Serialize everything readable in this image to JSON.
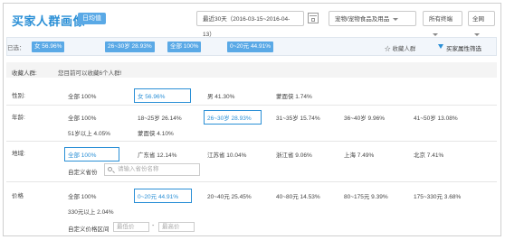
{
  "header": {
    "title": "买家人群画像",
    "tag": "日均值",
    "date_range": "最近30天（2016-03-15~2016-04-13）",
    "category": "宠物/宠物食品及用品",
    "terminal": "所有终端",
    "network": "全网"
  },
  "selected": {
    "label": "已选：",
    "chips": [
      "女 56.96%",
      "26~30岁 28.93%",
      "全部 100%",
      "0~20元 44.91%"
    ],
    "favorite": "收藏人群",
    "filter": "买家属性筛选"
  },
  "bookmark": {
    "label": "收藏人群:",
    "hint": "您目前可以收藏6个人群!"
  },
  "gender": {
    "label": "性别:",
    "options": [
      "全部  100%",
      "女  56.96%",
      "男  41.30%",
      "蒙面侠  1.74%"
    ]
  },
  "age": {
    "label": "年龄:",
    "options": [
      "全部  100%",
      "18~25岁  26.14%",
      "26~30岁  28.93%",
      "31~35岁  15.74%",
      "36~40岁  9.96%",
      "41~50岁  13.08%",
      "51岁以上  4.05%",
      "蒙面侠  4.10%"
    ]
  },
  "region": {
    "label": "地域:",
    "options": [
      "全部  100%",
      "广东省  12.14%",
      "江苏省  10.04%",
      "浙江省  9.06%",
      "上海  7.49%",
      "北京  7.41%"
    ],
    "custom_label": "自定义省份",
    "search_placeholder": "请输入省份名称"
  },
  "price": {
    "label": "价格",
    "options": [
      "全部  100%",
      "0~20元  44.91%",
      "20~40元  25.45%",
      "40~80元  14.53%",
      "80~175元  9.39%",
      "175~330元  3.68%",
      "330元以上  2.04%"
    ],
    "custom_label": "自定义价格区间",
    "min_placeholder": "最低价",
    "dash": "-",
    "max_placeholder": "最高价"
  }
}
